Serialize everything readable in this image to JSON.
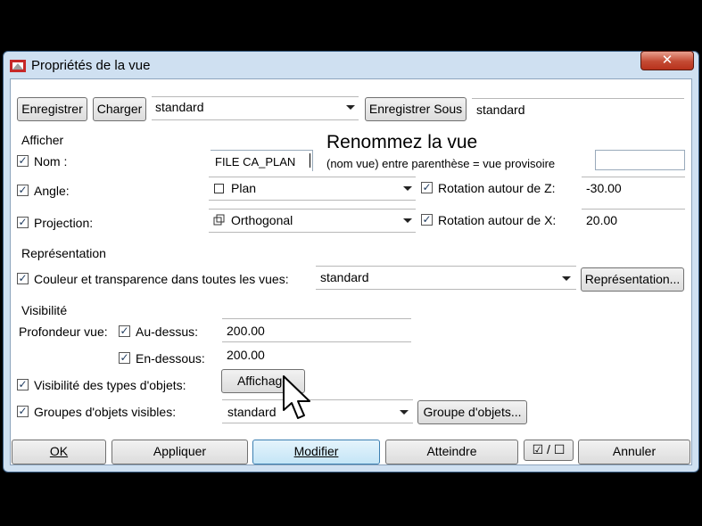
{
  "window": {
    "title": "Propriétés de la vue",
    "close_label": "✕"
  },
  "toolbar": {
    "save_label": "Enregistrer",
    "load_label": "Charger",
    "preset_value": "standard",
    "save_as_label": "Enregistrer Sous",
    "save_as_value": "standard"
  },
  "afficher": {
    "header": "Afficher",
    "name_label": "Nom :",
    "name_value": "FILE CA_PLAN",
    "angle_label": "Angle:",
    "angle_value": "Plan",
    "projection_label": "Projection:",
    "projection_value": "Orthogonal",
    "rot_z_label": "Rotation autour de Z:",
    "rot_z_value": "-30.00",
    "rot_x_label": "Rotation autour de X:",
    "rot_x_value": "20.00"
  },
  "overlay": {
    "title": "Renommez la vue",
    "subtitle": "(nom vue) entre parenthèse = vue provisoire"
  },
  "representation": {
    "header": "Représentation",
    "color_label": "Couleur et transparence dans toutes les vues:",
    "color_value": "standard",
    "button_label": "Représentation..."
  },
  "visibilite": {
    "header": "Visibilité",
    "depth_label": "Profondeur vue:",
    "above_label": "Au-dessus:",
    "above_value": "200.00",
    "below_label": "En-dessous:",
    "below_value": "200.00",
    "types_label": "Visibilité des types d'objets:",
    "affichage_label": "Affichage",
    "groups_label": "Groupes d'objets visibles:",
    "groups_value": "standard",
    "groups_button": "Groupe d'objets..."
  },
  "footer": {
    "ok": "OK",
    "apply": "Appliquer",
    "modify": "Modifier",
    "reach": "Atteindre",
    "toggle": "☑ / ☐",
    "cancel": "Annuler"
  },
  "colors": {
    "titlebar": "#cfe0f1",
    "close": "#c44a33",
    "primary": "#c4e5f6"
  }
}
